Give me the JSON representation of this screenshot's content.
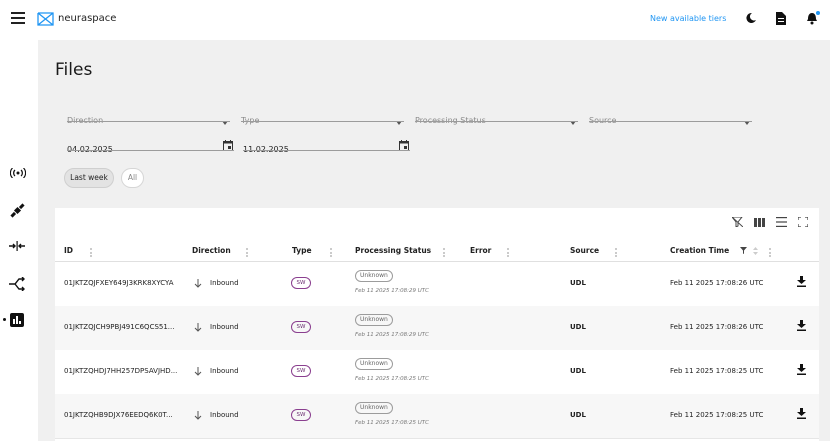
{
  "header": {
    "brand": "neuraspace",
    "tiers_link": "New available tiers",
    "icons": [
      "menu-icon",
      "theme-toggle-icon",
      "document-icon",
      "notification-bell-icon"
    ]
  },
  "sidebar": {
    "items": [
      {
        "name": "antenna-icon"
      },
      {
        "name": "satellite-icon"
      },
      {
        "name": "maneuver-icon"
      },
      {
        "name": "routes-icon"
      },
      {
        "name": "analytics-icon",
        "active": true
      }
    ]
  },
  "page": {
    "title": "Files"
  },
  "filters": {
    "direction": "Direction",
    "type": "Type",
    "processing_status": "Processing Status",
    "source": "Source",
    "date_from": "04.02.2025",
    "date_to": "11.02.2025",
    "chip_last_week": "Last week",
    "chip_all": "All"
  },
  "table": {
    "columns": [
      "ID",
      "Direction",
      "Type",
      "Processing Status",
      "Error",
      "Source",
      "Creation Time"
    ],
    "rows": [
      {
        "id": "01JKTZQJFXEY649J3KRK8XYCYA",
        "direction": "Inbound",
        "type": "SW",
        "status": "Unknown",
        "status_time": "Feb 11 2025 17:08:29 UTC",
        "error": "",
        "source": "UDL",
        "created": "Feb 11 2025 17:08:26 UTC"
      },
      {
        "id": "01JKTZQJCH9PBJ491C6QCS51...",
        "direction": "Inbound",
        "type": "SW",
        "status": "Unknown",
        "status_time": "Feb 11 2025 17:08:29 UTC",
        "error": "",
        "source": "UDL",
        "created": "Feb 11 2025 17:08:26 UTC"
      },
      {
        "id": "01JKTZQHDJ7HH257DPSAVJHD...",
        "direction": "Inbound",
        "type": "SW",
        "status": "Unknown",
        "status_time": "Feb 11 2025 17:08:25 UTC",
        "error": "",
        "source": "UDL",
        "created": "Feb 11 2025 17:08:25 UTC"
      },
      {
        "id": "01JKTZQHB9DJX76EEDQ6K0T...",
        "direction": "Inbound",
        "type": "SW",
        "status": "Unknown",
        "status_time": "Feb 11 2025 17:08:25 UTC",
        "error": "",
        "source": "UDL",
        "created": "Feb 11 2025 17:08:25 UTC"
      }
    ]
  },
  "colors": {
    "accent": "#2196f3",
    "sw_badge": "#8a3f8f",
    "header_bg": "#ffffff",
    "page_bg": "#f0f0f0"
  }
}
